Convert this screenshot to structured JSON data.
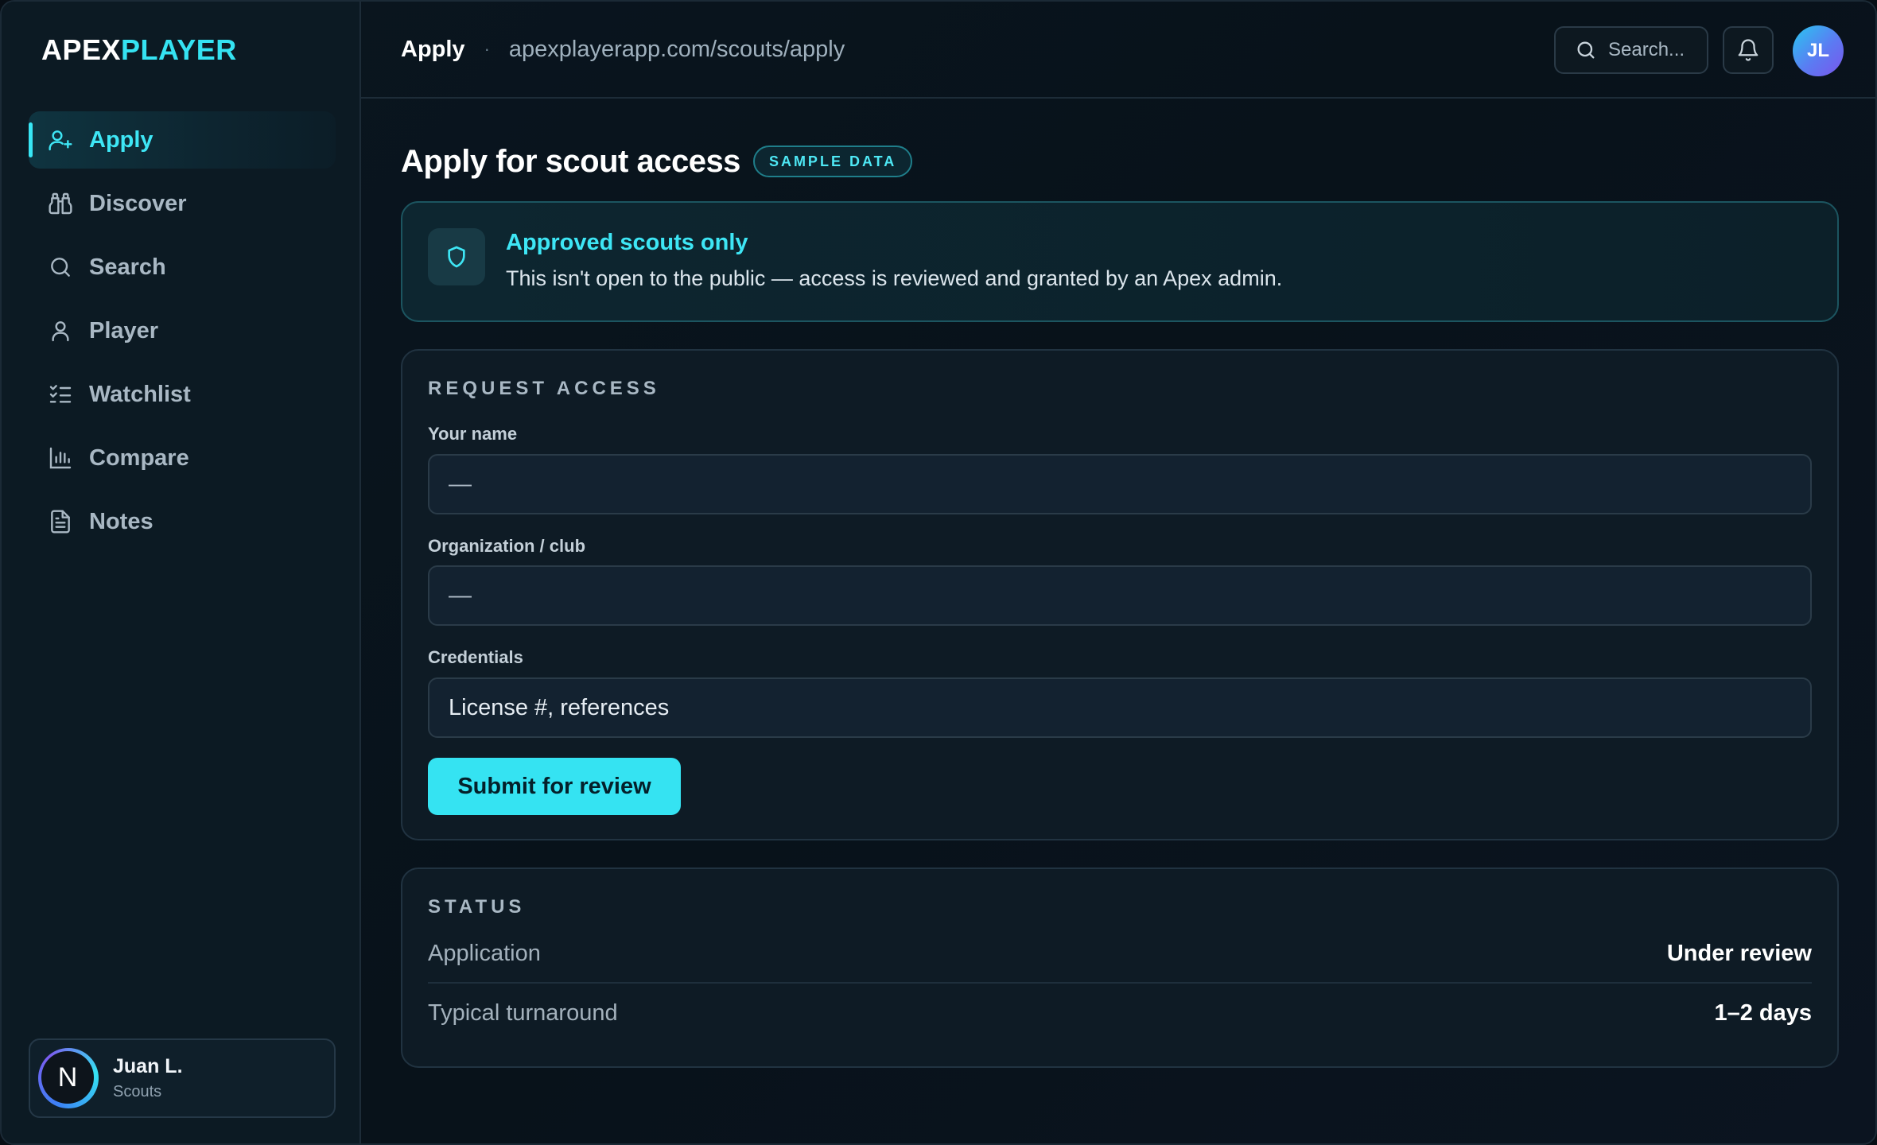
{
  "brand": {
    "part1": "APEX",
    "part2": "PLAYER"
  },
  "sidebar": {
    "items": [
      {
        "label": "Apply",
        "icon": "user-plus-icon",
        "active": true
      },
      {
        "label": "Discover",
        "icon": "binoculars-icon"
      },
      {
        "label": "Search",
        "icon": "search-icon"
      },
      {
        "label": "Player",
        "icon": "user-icon"
      },
      {
        "label": "Watchlist",
        "icon": "list-checks-icon"
      },
      {
        "label": "Compare",
        "icon": "bar-chart-icon"
      },
      {
        "label": "Notes",
        "icon": "file-text-icon"
      }
    ],
    "user": {
      "initial": "N",
      "name": "Juan L.",
      "role": "Scouts"
    }
  },
  "topbar": {
    "title": "Apply",
    "separator": "·",
    "url": "apexplayerapp.com/scouts/apply",
    "search_placeholder": "Search...",
    "avatar_initials": "JL"
  },
  "page": {
    "title": "Apply for scout access",
    "badge": "SAMPLE DATA"
  },
  "notice": {
    "title": "Approved scouts only",
    "body": "This isn't open to the public — access is reviewed and granted by an Apex admin."
  },
  "form": {
    "section_label": "REQUEST ACCESS",
    "fields": [
      {
        "label": "Your name",
        "value": "—"
      },
      {
        "label": "Organization / club",
        "value": "—"
      },
      {
        "label": "Credentials",
        "value": "License #, references"
      }
    ],
    "submit_label": "Submit for review"
  },
  "status": {
    "section_label": "STATUS",
    "rows": [
      {
        "key": "Application",
        "value": "Under review"
      },
      {
        "key": "Typical turnaround",
        "value": "1–2 days"
      }
    ]
  },
  "colors": {
    "accent": "#35e3f2",
    "background": "#070e15",
    "sidebar": "#0c1a23",
    "card": "#0e1b25"
  }
}
